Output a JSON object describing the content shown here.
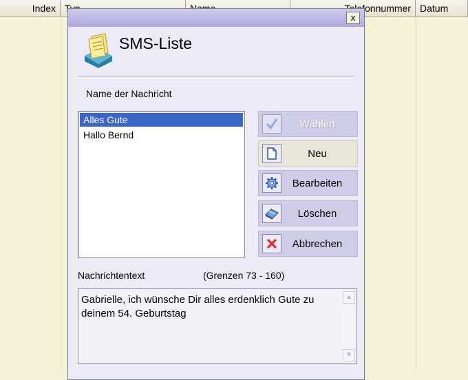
{
  "background_table": {
    "columns": [
      "Index",
      "Typ",
      "Name",
      "Telefonnummer",
      "Datum"
    ]
  },
  "dialog": {
    "title": "SMS-Liste",
    "close_label": "x",
    "name_label": "Name der Nachricht",
    "messages": [
      {
        "label": "Alles Gute",
        "selected": true
      },
      {
        "label": "Hallo Bernd",
        "selected": false
      }
    ],
    "buttons": {
      "select": "Wählen",
      "new": "Neu",
      "edit": "Bearbeiten",
      "delete": "Löschen",
      "cancel": "Abbrechen"
    },
    "text_label": "Nachrichtentext",
    "limits_label": "(Grenzen 73 - 160)",
    "message_text": "Gabrielle, ich wünsche Dir alles erdenklich Gute zu deinem 54. Geburtstag"
  },
  "colors": {
    "background": "#f4f2d6",
    "dialog": "#ecebf5",
    "selection": "#3a66c9",
    "button": "#cfcce8"
  },
  "icons": [
    "sms-list-icon",
    "check-icon",
    "new-document-icon",
    "gear-icon",
    "eraser-icon",
    "red-x-icon",
    "scroll-up-icon",
    "scroll-down-icon"
  ]
}
